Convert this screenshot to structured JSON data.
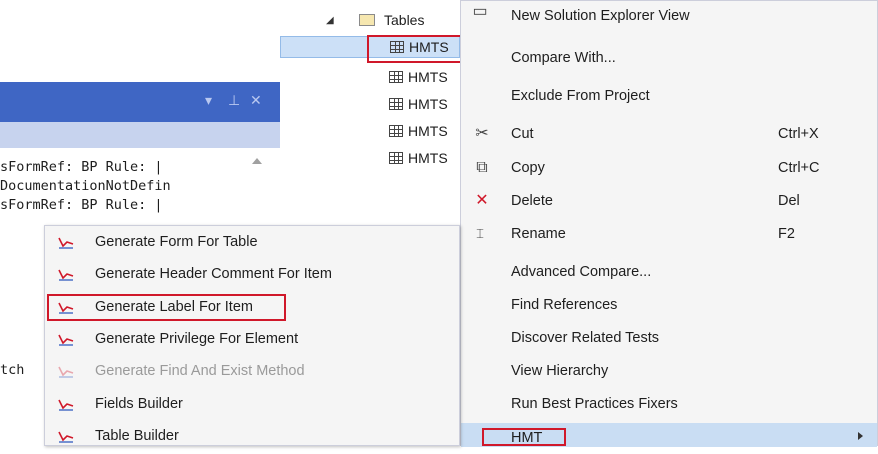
{
  "solution_explorer": {
    "folder_label": "Tables",
    "items": [
      "HMTS",
      "HMTS",
      "HMTS",
      "HMTS",
      "HMTS"
    ]
  },
  "output_window": {
    "lines": [
      "sFormRef: BP Rule: |",
      "DocumentationNotDefin",
      "sFormRef: BP Rule: |",
      "tch"
    ]
  },
  "context_menu": {
    "items": [
      {
        "label": "New Solution Explorer View",
        "shortcut": "",
        "icon": "solution-view-icon"
      },
      {
        "label": "Compare With...",
        "shortcut": "",
        "icon": ""
      },
      {
        "label": "Exclude From Project",
        "shortcut": "",
        "icon": ""
      },
      {
        "label": "Cut",
        "shortcut": "Ctrl+X",
        "icon": "scissors-icon"
      },
      {
        "label": "Copy",
        "shortcut": "Ctrl+C",
        "icon": "copy-icon"
      },
      {
        "label": "Delete",
        "shortcut": "Del",
        "icon": "delete-x-icon"
      },
      {
        "label": "Rename",
        "shortcut": "F2",
        "icon": "rename-icon"
      },
      {
        "label": "Advanced Compare...",
        "shortcut": "",
        "icon": ""
      },
      {
        "label": "Find References",
        "shortcut": "",
        "icon": ""
      },
      {
        "label": "Discover Related Tests",
        "shortcut": "",
        "icon": ""
      },
      {
        "label": "View Hierarchy",
        "shortcut": "",
        "icon": ""
      },
      {
        "label": "Run Best Practices Fixers",
        "shortcut": "",
        "icon": ""
      },
      {
        "label": "HMT",
        "shortcut": "",
        "icon": ""
      }
    ]
  },
  "submenu": {
    "items": [
      {
        "label": "Generate Form For Table",
        "enabled": true
      },
      {
        "label": "Generate Header Comment For Item",
        "enabled": true
      },
      {
        "label": "Generate Label For Item",
        "enabled": true
      },
      {
        "label": "Generate Privilege For Element",
        "enabled": true
      },
      {
        "label": "Generate Find And Exist Method",
        "enabled": false
      },
      {
        "label": "Fields Builder",
        "enabled": true
      },
      {
        "label": "Table Builder",
        "enabled": true
      }
    ]
  },
  "colors": {
    "highlight_box": "#d0182a",
    "tool_header": "#3f66c4",
    "selection": "#cce0f7"
  }
}
